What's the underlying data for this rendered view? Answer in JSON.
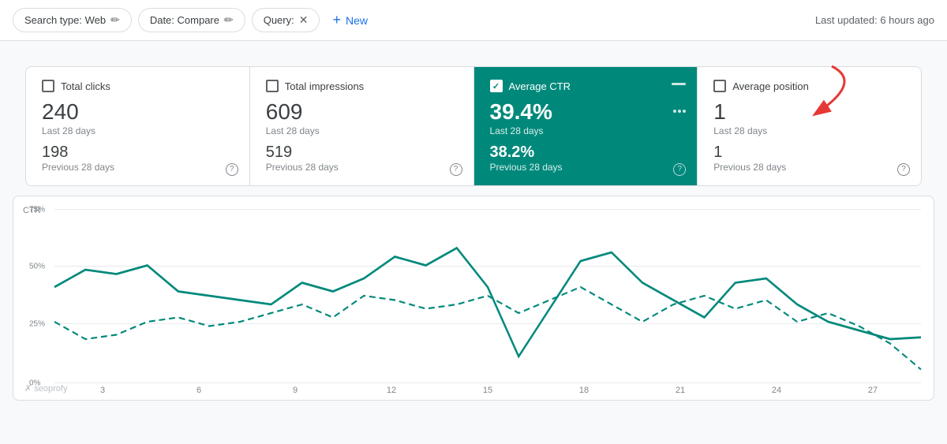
{
  "toolbar": {
    "search_type_label": "Search type: Web",
    "date_label": "Date: Compare",
    "query_label": "Query:",
    "new_label": "New",
    "last_updated": "Last updated: 6 hours ago"
  },
  "metrics": [
    {
      "id": "total-clicks",
      "label": "Total clicks",
      "checked": false,
      "active": false,
      "value_main": "240",
      "period_main": "Last 28 days",
      "value_secondary": "198",
      "period_secondary": "Previous 28 days"
    },
    {
      "id": "total-impressions",
      "label": "Total impressions",
      "checked": false,
      "active": false,
      "value_main": "609",
      "period_main": "Last 28 days",
      "value_secondary": "519",
      "period_secondary": "Previous 28 days"
    },
    {
      "id": "average-ctr",
      "label": "Average CTR",
      "checked": true,
      "active": true,
      "value_main": "39.4%",
      "period_main": "Last 28 days",
      "value_secondary": "38.2%",
      "period_secondary": "Previous 28 days"
    },
    {
      "id": "average-position",
      "label": "Average position",
      "checked": false,
      "active": false,
      "value_main": "1",
      "period_main": "Last 28 days",
      "value_secondary": "1",
      "period_secondary": "Previous 28 days"
    }
  ],
  "chart": {
    "y_label": "CTR",
    "y_ticks": [
      "75%",
      "50%",
      "25%",
      "0%"
    ],
    "x_labels": [
      "3",
      "6",
      "9",
      "12",
      "15",
      "18",
      "21",
      "24",
      "27"
    ],
    "watermark": "✗ seoprofy"
  }
}
